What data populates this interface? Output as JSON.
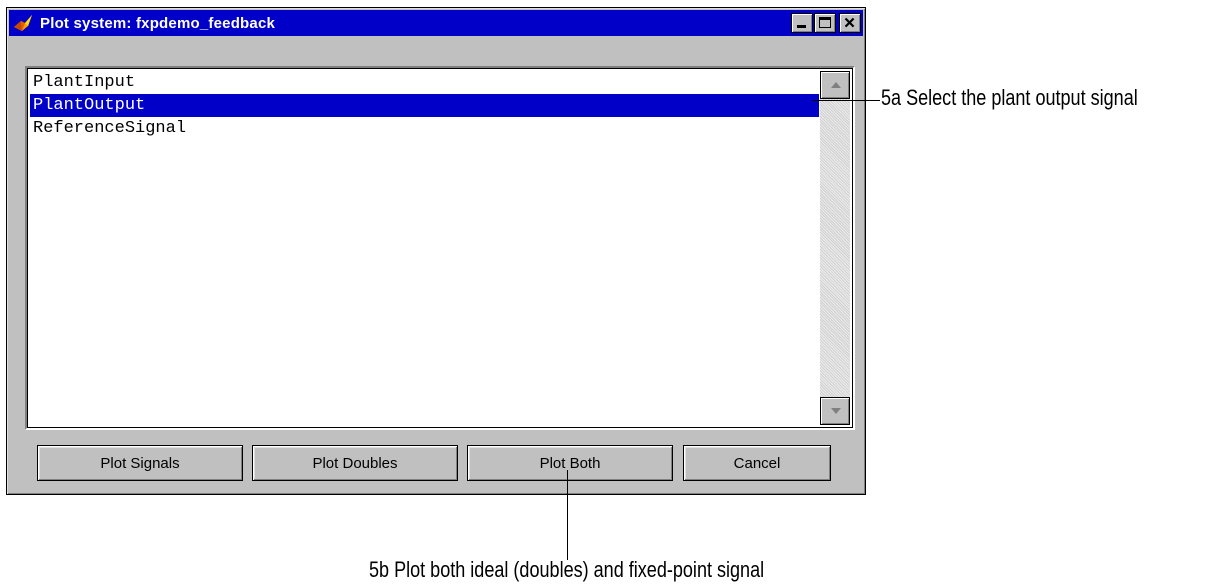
{
  "window": {
    "title": "Plot system: fxpdemo_feedback",
    "title_bar_color": "#0000c8"
  },
  "signal_list": {
    "items": [
      "PlantInput",
      "PlantOutput",
      "ReferenceSignal"
    ],
    "selected": "PlantOutput",
    "selection_color": "#0000c8"
  },
  "buttons": {
    "plot_signals": "Plot Signals",
    "plot_doubles": "Plot Doubles",
    "plot_both": "Plot Both",
    "cancel": "Cancel"
  },
  "callouts": {
    "step_5a": "5a Select the plant output signal",
    "step_5b": "5b Plot both ideal (doubles) and fixed-point signal"
  },
  "icons": [
    "matlab-app-icon",
    "minimize-icon",
    "maximize-icon",
    "close-icon",
    "scroll-up-arrow-icon",
    "scroll-down-arrow-icon"
  ]
}
